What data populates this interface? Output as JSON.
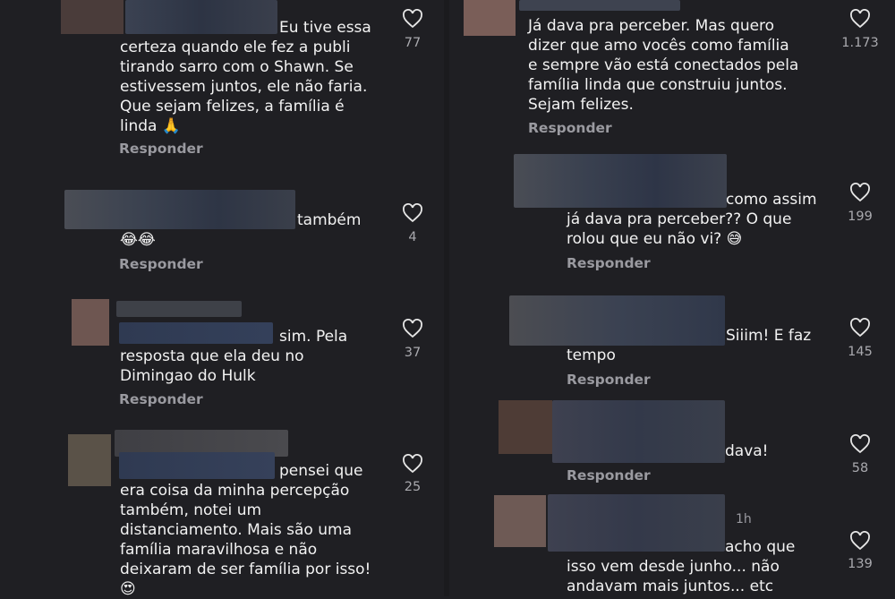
{
  "reply_label": "Responder",
  "left_comments": [
    {
      "text": "Eu tive essa\ncerteza quando ele fez a publi\ntirando sarro com o Shawn. Se\nestivessem juntos, ele não faria.\nQue sejam felizes, a família é\nlinda 🙏",
      "likes": "77"
    },
    {
      "text": "também\n😂😂",
      "likes": "4"
    },
    {
      "text": "sim. Pela\nresposta que ela deu no\nDimingao do Hulk",
      "likes": "37"
    },
    {
      "text": "pensei que\nera coisa da minha percepção\ntambém, notei um\ndistanciamento. Mais são uma\nfamília maravilhosa e não\ndeixaram de ser família por isso!\n😍",
      "likes": "25"
    }
  ],
  "right_comments": [
    {
      "text": "Já dava pra perceber. Mas quero\ndizer que amo vocês como família\ne sempre vão está conectados pela\nfamília linda que construiu juntos.\nSejam felizes.",
      "likes": "1.173"
    },
    {
      "text": "como assim\njá dava pra perceber?? O que\nrolou que eu não vi? 😅",
      "likes": "199"
    },
    {
      "text": "Siiim! E faz\ntempo",
      "likes": "145"
    },
    {
      "text": "dava!",
      "likes": "58"
    },
    {
      "text": "acho que\nisso vem desde junho... não\nandavam mais juntos... etc",
      "likes": "139",
      "time": "1h"
    }
  ],
  "colors": {
    "background": "#1f1f23",
    "text": "#f2f2f2",
    "muted": "#9a9aa0"
  }
}
